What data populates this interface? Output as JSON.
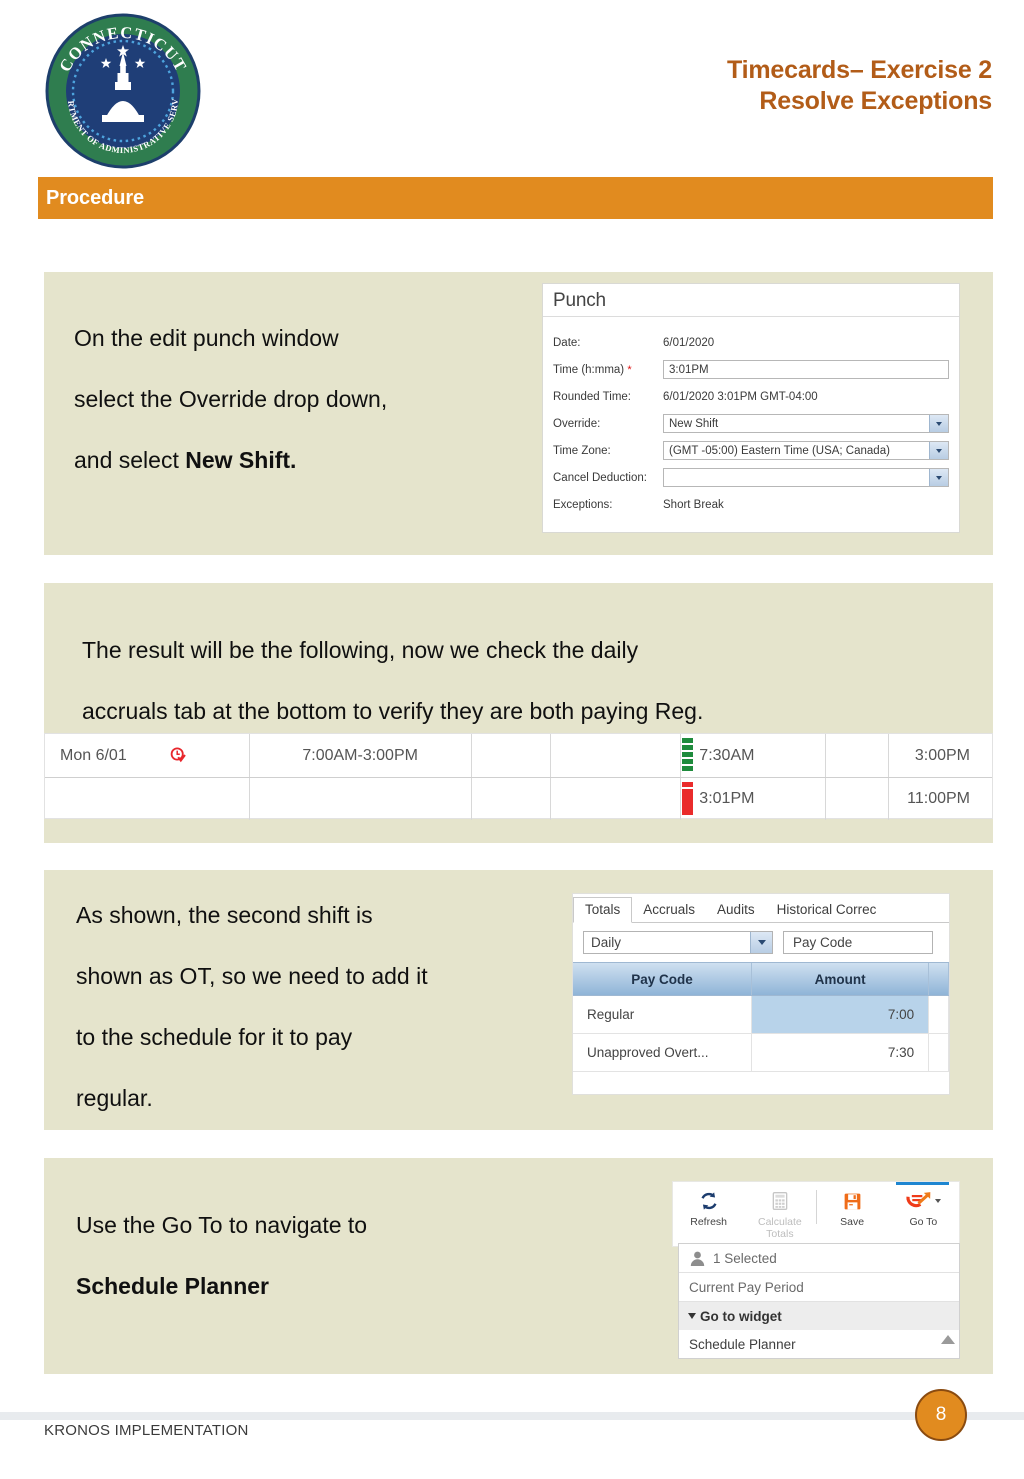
{
  "header": {
    "logo_alt": "Connecticut Department of Administrative Services seal",
    "logo_outer_text": "CONNECTICUT",
    "logo_inner_text": "DEPARTMENT OF ADMINISTRATIVE SERVICES",
    "title_line1": "Timecards– Exercise 2",
    "title_line2": "Resolve Exceptions",
    "title_color": "#b25c18"
  },
  "section_bar": {
    "label": "Procedure",
    "color": "#e18b1f"
  },
  "steps": [
    {
      "id": "step-1",
      "lines": [
        {
          "text": "On the edit punch window",
          "bold": false
        },
        {
          "text": "select the Override drop down,",
          "bold": false
        },
        {
          "text": "and select ",
          "bold_suffix": "New Shift."
        }
      ]
    },
    {
      "id": "step-2",
      "lines": [
        {
          "text": "The result will be the following, now we check the daily",
          "bold": false
        },
        {
          "text": "accruals tab at the bottom to verify they are both paying Reg.",
          "bold": false
        }
      ]
    },
    {
      "id": "step-3",
      "lines": [
        {
          "text": "As shown, the second shift is",
          "bold": false
        },
        {
          "text": "shown as OT, so we need to add it",
          "bold": false
        },
        {
          "text": "to the schedule for it to pay",
          "bold": false
        },
        {
          "text": "regular.",
          "bold": false
        }
      ]
    },
    {
      "id": "step-4",
      "lines": [
        {
          "text": "Use the Go To to navigate to",
          "bold": false
        },
        {
          "text": "Schedule Planner",
          "bold": true
        }
      ]
    }
  ],
  "step1_text": {
    "line1": "On the edit punch window",
    "line2": "select the Override drop down,",
    "line3_plain": "and select ",
    "line3_bold": "New Shift."
  },
  "step2_text": {
    "line1": "The result will be the following, now we check the daily",
    "line2": "accruals tab at the bottom to verify they are both paying Reg."
  },
  "step3_text": {
    "line1": "As shown, the second shift is",
    "line2": "shown as OT, so we need to add it",
    "line3": "to the schedule for it to pay",
    "line4": "regular."
  },
  "step4_text": {
    "line1": "Use the Go To to navigate to",
    "line2": "Schedule Planner"
  },
  "punch_dialog": {
    "title": "Punch",
    "fields": {
      "date_label": "Date:",
      "date_value": "6/01/2020",
      "time_label": "Time (h:mma)",
      "time_required_marker": "*",
      "time_value": "3:01PM",
      "rounded_label": "Rounded Time:",
      "rounded_value": "6/01/2020 3:01PM GMT-04:00",
      "override_label": "Override:",
      "override_value": "New Shift",
      "timezone_label": "Time Zone:",
      "timezone_value": "(GMT -05:00) Eastern Time (USA; Canada)",
      "cancel_deduction_label": "Cancel Deduction:",
      "cancel_deduction_value": "",
      "exceptions_label": "Exceptions:",
      "exceptions_value": "Short Break"
    }
  },
  "timecard": {
    "rows": [
      {
        "date": "Mon 6/01",
        "exception_icon": "clock-exception-icon",
        "schedule": "7:00AM-3:00PM",
        "col3": "",
        "col4": "",
        "in_time": "7:30AM",
        "in_marker_color": "#1e8b3c",
        "col6": "",
        "out_time": "3:00PM"
      },
      {
        "date": "",
        "exception_icon": "",
        "schedule": "",
        "col3": "",
        "col4": "",
        "in_time": "3:01PM",
        "in_marker_color": "#ea2b2b",
        "col6": "",
        "out_time": "11:00PM"
      }
    ]
  },
  "totals_panel": {
    "tabs": [
      {
        "label": "Totals",
        "active": true
      },
      {
        "label": "Accruals",
        "active": false
      },
      {
        "label": "Audits",
        "active": false
      },
      {
        "label": "Historical Correc",
        "active": false
      }
    ],
    "period_select_value": "Daily",
    "paycode_filter_value": "Pay Code",
    "columns": [
      "Pay Code",
      "Amount"
    ],
    "rows": [
      {
        "pay_code": "Regular",
        "amount": "7:00",
        "highlighted": true
      },
      {
        "pay_code": "Unapproved Overt...",
        "amount": "7:30",
        "highlighted": false
      }
    ]
  },
  "goto_panel": {
    "toolbar": [
      {
        "label": "Refresh",
        "icon": "refresh-icon",
        "disabled": false
      },
      {
        "label": "Calculate Totals",
        "label_line1": "Calculate",
        "label_line2": "Totals",
        "icon": "calculator-icon",
        "disabled": true
      },
      {
        "label": "Save",
        "icon": "save-icon",
        "disabled": false
      },
      {
        "label": "Go To",
        "icon": "goto-arrow-icon",
        "disabled": false
      }
    ],
    "dropdown": {
      "selected_count": "1 Selected",
      "pay_period": "Current Pay Period",
      "group_label": "Go to widget",
      "item": "Schedule Planner"
    }
  },
  "footer": {
    "text": "KRONOS IMPLEMENTATION",
    "page_number": "8",
    "badge_color": "#e18b1f"
  }
}
